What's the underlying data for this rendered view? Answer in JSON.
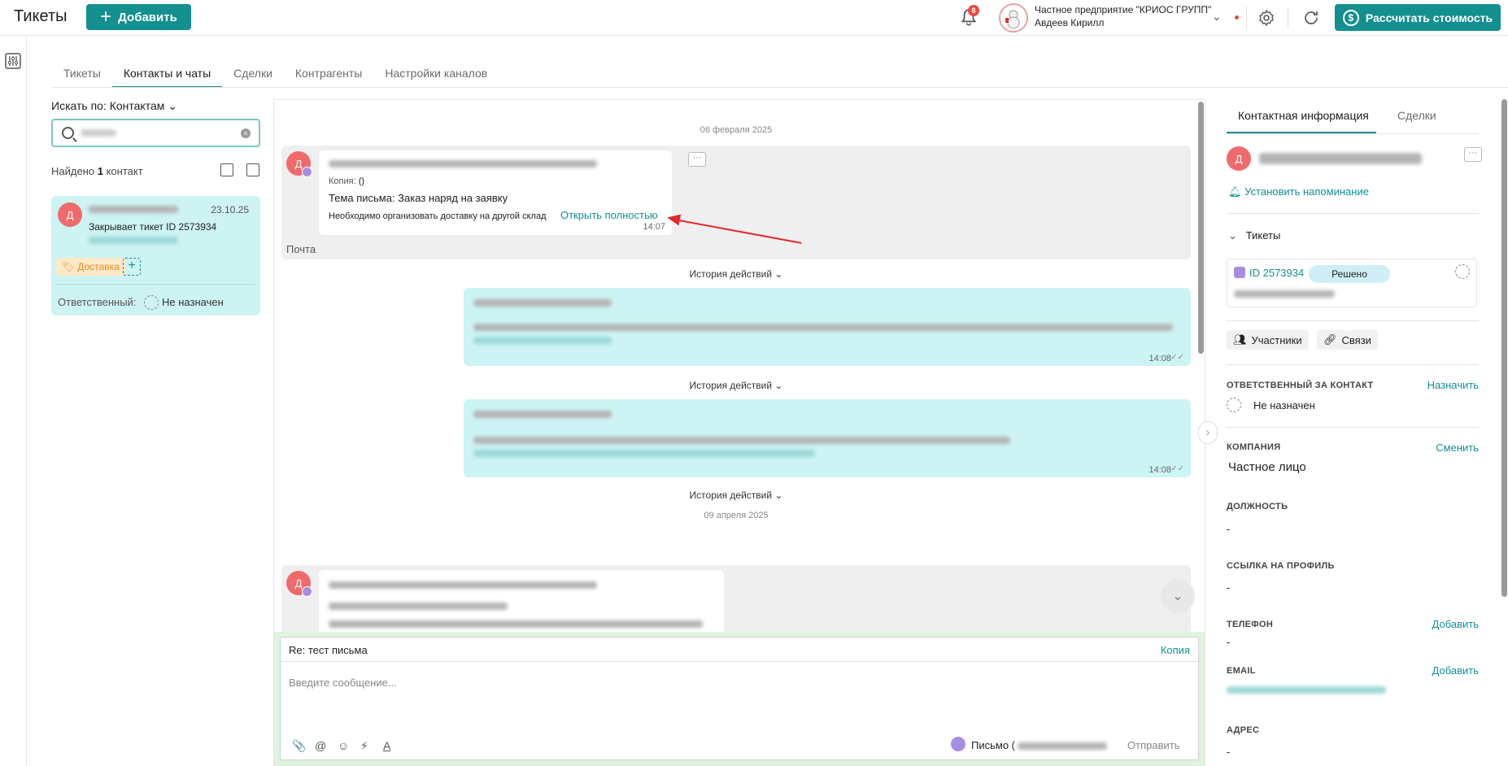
{
  "header": {
    "app_title": "Тикеты",
    "add_label": "Добавить",
    "notifications_count": "8",
    "company_name": "Частное предприятие \"КРИОС ГРУПП\"",
    "user_name": "Авдеев Кирилл",
    "calc_label": "Рассчитать стоимость"
  },
  "tabs": [
    "Тикеты",
    "Контакты и чаты",
    "Сделки",
    "Контрагенты",
    "Настройки каналов"
  ],
  "contacts": {
    "search_by": "Искать по: Контактам",
    "found_prefix": "Найдено",
    "found_count": "1",
    "found_suffix": "контакт",
    "card": {
      "date": "23.10.25",
      "text": "Закрывает тикет ID 2573934",
      "tag": "Доставка",
      "responsible_label": "Ответственный:",
      "responsible_value": "Не назначен",
      "avatar": "Д"
    }
  },
  "chat": {
    "date1": "06 февраля 2025",
    "msg1": {
      "avatar": "Д",
      "copy_label": "Копия:",
      "copy_value": "()",
      "subject": "Тема письма: Заказ наряд на заявку",
      "body": "Необходимо организовать доставку на другой склад",
      "open_full": "Открыть полностью",
      "time": "14:07",
      "channel": "Почта"
    },
    "history1": "История действий",
    "time2": "14:08",
    "history2": "История действий",
    "time3": "14:08",
    "history3": "История действий",
    "date2": "09 апреля 2025",
    "msg4_avatar": "Д"
  },
  "composer": {
    "subject": "Re: тест письма",
    "copy_label": "Копия",
    "placeholder": "Введите сообщение...",
    "letter_label": "Письмо (",
    "send_label": "Отправить"
  },
  "right_panel": {
    "tab_contact": "Контактная информация",
    "tab_deals": "Сделки",
    "avatar": "Д",
    "reminder": "Установить напоминание",
    "tickets_title": "Тикеты",
    "ticket_id": "ID 2573934",
    "ticket_status": "Решено",
    "participants": "Участники",
    "links": "Связи",
    "responsible_label": "ОТВЕТСТВЕННЫЙ ЗА КОНТАКТ",
    "assign": "Назначить",
    "responsible_value": "Не назначен",
    "company_label": "КОМПАНИЯ",
    "change": "Сменить",
    "company_value": "Частное лицо",
    "position_label": "ДОЛЖНОСТЬ",
    "position_value": "-",
    "profile_label": "ССЫЛКА НА ПРОФИЛЬ",
    "profile_value": "-",
    "phone_label": "ТЕЛЕФОН",
    "phone_add": "Добавить",
    "phone_value": "-",
    "email_label": "EMAIL",
    "email_add": "Добавить",
    "address_label": "АДРЕС",
    "address_value": "-"
  },
  "colors": {
    "accent": "#138f8f",
    "outgoing": "#cdf4f4",
    "avatar": "#ef6b6b",
    "arrow": "#e02a2a"
  }
}
